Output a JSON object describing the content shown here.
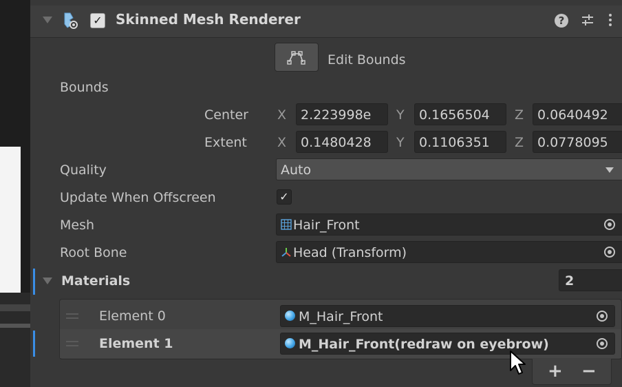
{
  "component": {
    "title": "Skinned Mesh Renderer",
    "enabled_check": "✓"
  },
  "edit_bounds": {
    "label": "Edit Bounds"
  },
  "bounds": {
    "label": "Bounds",
    "center": {
      "label": "Center",
      "x_label": "X",
      "y_label": "Y",
      "z_label": "Z",
      "x": "2.223998e",
      "y": "0.1656504",
      "z": "0.0640492"
    },
    "extent": {
      "label": "Extent",
      "x_label": "X",
      "y_label": "Y",
      "z_label": "Z",
      "x": "0.1480428",
      "y": "0.1106351",
      "z": "0.0778095"
    }
  },
  "quality": {
    "label": "Quality",
    "value": "Auto"
  },
  "update_when_offscreen": {
    "label": "Update When Offscreen",
    "checked": true,
    "check_glyph": "✓"
  },
  "mesh": {
    "label": "Mesh",
    "value": "Hair_Front"
  },
  "root_bone": {
    "label": "Root Bone",
    "value": "Head (Transform)"
  },
  "materials": {
    "label": "Materials",
    "count": "2",
    "items": [
      {
        "label": "Element 0",
        "value": "M_Hair_Front"
      },
      {
        "label": "Element 1",
        "value": "M_Hair_Front(redraw on eyebrow)"
      }
    ],
    "add_label": "+",
    "remove_label": "−"
  },
  "colors": {
    "panel": "#383838",
    "field": "#2a2a2a",
    "selection_accent": "#3a8ee6"
  }
}
